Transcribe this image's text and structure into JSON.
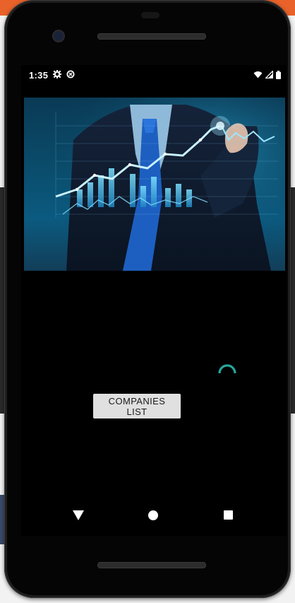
{
  "statusbar": {
    "time": "1:35",
    "icons": [
      "gear-icon",
      "data-saver-icon",
      "wifi-icon",
      "signal-icon",
      "battery-icon"
    ]
  },
  "hero": {
    "description_icon": "stock-chart-businessman-image"
  },
  "main": {
    "companies_button_label": "COMPANIES LIST"
  },
  "navbar": {
    "icons": [
      "back-icon",
      "home-icon",
      "recents-icon"
    ]
  },
  "colors": {
    "screen_background": "#000000",
    "button_background": "#e0e0e0",
    "spinner_accent": "#26a69a"
  }
}
